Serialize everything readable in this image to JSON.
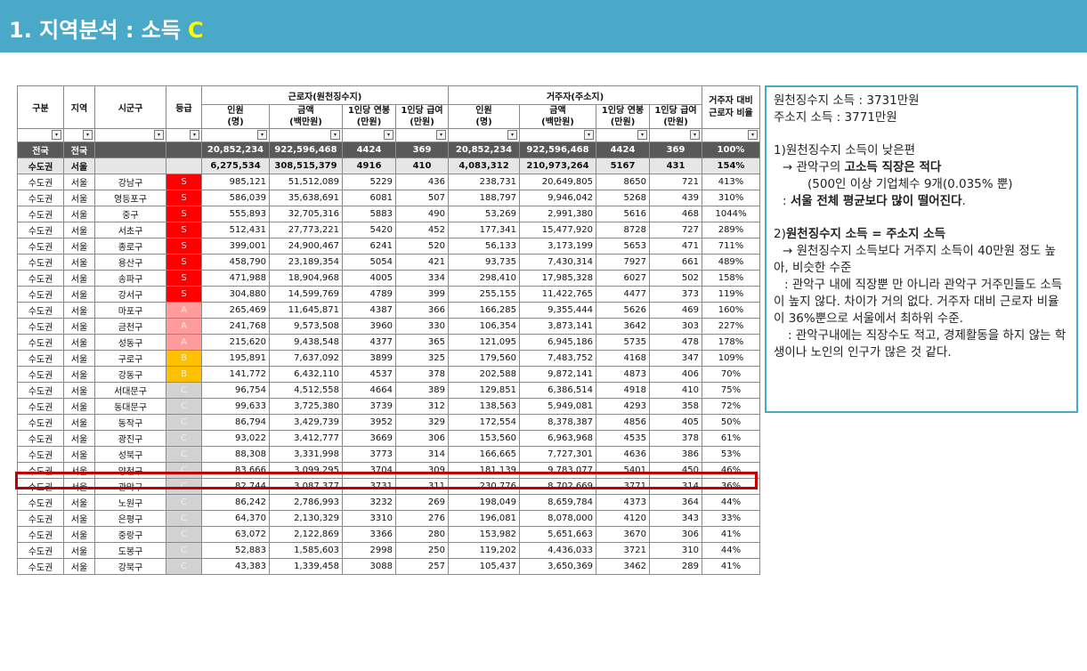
{
  "header": {
    "title": "1. 지역분석 : 소득",
    "grade": "C"
  },
  "table": {
    "head_left": [
      "구분",
      "지역",
      "시군구",
      "등급"
    ],
    "group_worker": "근로자(원천징수지)",
    "group_resident": "거주자(주소지)",
    "ratio_head": "거주자 대비 근로자 비율",
    "sub_cols": [
      "인원",
      "(명)",
      "금액",
      "(백만원)",
      "1인당 연봉",
      "(만원)",
      "1인당 급여",
      "(만원)"
    ],
    "filter_symbol": "▾",
    "rows": [
      [
        "전국",
        "전국",
        "",
        "",
        "20,852,234",
        "922,596,468",
        "4424",
        "369",
        "20,852,234",
        "922,596,468",
        "4424",
        "369",
        "100%"
      ],
      [
        "수도권",
        "서울",
        "",
        "",
        "6,275,534",
        "308,515,379",
        "4916",
        "410",
        "4,083,312",
        "210,973,264",
        "5167",
        "431",
        "154%"
      ],
      [
        "수도권",
        "서울",
        "강남구",
        "S",
        "985,121",
        "51,512,089",
        "5229",
        "436",
        "238,731",
        "20,649,805",
        "8650",
        "721",
        "413%"
      ],
      [
        "수도권",
        "서울",
        "영등포구",
        "S",
        "586,039",
        "35,638,691",
        "6081",
        "507",
        "188,797",
        "9,946,042",
        "5268",
        "439",
        "310%"
      ],
      [
        "수도권",
        "서울",
        "중구",
        "S",
        "555,893",
        "32,705,316",
        "5883",
        "490",
        "53,269",
        "2,991,380",
        "5616",
        "468",
        "1044%"
      ],
      [
        "수도권",
        "서울",
        "서초구",
        "S",
        "512,431",
        "27,773,221",
        "5420",
        "452",
        "177,341",
        "15,477,920",
        "8728",
        "727",
        "289%"
      ],
      [
        "수도권",
        "서울",
        "종로구",
        "S",
        "399,001",
        "24,900,467",
        "6241",
        "520",
        "56,133",
        "3,173,199",
        "5653",
        "471",
        "711%"
      ],
      [
        "수도권",
        "서울",
        "용산구",
        "S",
        "458,790",
        "23,189,354",
        "5054",
        "421",
        "93,735",
        "7,430,314",
        "7927",
        "661",
        "489%"
      ],
      [
        "수도권",
        "서울",
        "송파구",
        "S",
        "471,988",
        "18,904,968",
        "4005",
        "334",
        "298,410",
        "17,985,328",
        "6027",
        "502",
        "158%"
      ],
      [
        "수도권",
        "서울",
        "강서구",
        "S",
        "304,880",
        "14,599,769",
        "4789",
        "399",
        "255,155",
        "11,422,765",
        "4477",
        "373",
        "119%"
      ],
      [
        "수도권",
        "서울",
        "마포구",
        "A",
        "265,469",
        "11,645,871",
        "4387",
        "366",
        "166,285",
        "9,355,444",
        "5626",
        "469",
        "160%"
      ],
      [
        "수도권",
        "서울",
        "금천구",
        "A",
        "241,768",
        "9,573,508",
        "3960",
        "330",
        "106,354",
        "3,873,141",
        "3642",
        "303",
        "227%"
      ],
      [
        "수도권",
        "서울",
        "성동구",
        "A",
        "215,620",
        "9,438,548",
        "4377",
        "365",
        "121,095",
        "6,945,186",
        "5735",
        "478",
        "178%"
      ],
      [
        "수도권",
        "서울",
        "구로구",
        "B",
        "195,891",
        "7,637,092",
        "3899",
        "325",
        "179,560",
        "7,483,752",
        "4168",
        "347",
        "109%"
      ],
      [
        "수도권",
        "서울",
        "강동구",
        "B",
        "141,772",
        "6,432,110",
        "4537",
        "378",
        "202,588",
        "9,872,141",
        "4873",
        "406",
        "70%"
      ],
      [
        "수도권",
        "서울",
        "서대문구",
        "C",
        "96,754",
        "4,512,558",
        "4664",
        "389",
        "129,851",
        "6,386,514",
        "4918",
        "410",
        "75%"
      ],
      [
        "수도권",
        "서울",
        "동대문구",
        "C",
        "99,633",
        "3,725,380",
        "3739",
        "312",
        "138,563",
        "5,949,081",
        "4293",
        "358",
        "72%"
      ],
      [
        "수도권",
        "서울",
        "동작구",
        "C",
        "86,794",
        "3,429,739",
        "3952",
        "329",
        "172,554",
        "8,378,387",
        "4856",
        "405",
        "50%"
      ],
      [
        "수도권",
        "서울",
        "광진구",
        "C",
        "93,022",
        "3,412,777",
        "3669",
        "306",
        "153,560",
        "6,963,968",
        "4535",
        "378",
        "61%"
      ],
      [
        "수도권",
        "서울",
        "성북구",
        "C",
        "88,308",
        "3,331,998",
        "3773",
        "314",
        "166,665",
        "7,727,301",
        "4636",
        "386",
        "53%"
      ],
      [
        "수도권",
        "서울",
        "양천구",
        "C",
        "83,666",
        "3,099,295",
        "3704",
        "309",
        "181,139",
        "9,783,077",
        "5401",
        "450",
        "46%"
      ],
      [
        "수도권",
        "서울",
        "관악구",
        "C",
        "82,744",
        "3,087,377",
        "3731",
        "311",
        "230,776",
        "8,702,669",
        "3771",
        "314",
        "36%"
      ],
      [
        "수도권",
        "서울",
        "노원구",
        "C",
        "86,242",
        "2,786,993",
        "3232",
        "269",
        "198,049",
        "8,659,784",
        "4373",
        "364",
        "44%"
      ],
      [
        "수도권",
        "서울",
        "은평구",
        "C",
        "64,370",
        "2,130,329",
        "3310",
        "276",
        "196,081",
        "8,078,000",
        "4120",
        "343",
        "33%"
      ],
      [
        "수도권",
        "서울",
        "중랑구",
        "C",
        "63,072",
        "2,122,869",
        "3366",
        "280",
        "153,982",
        "5,651,663",
        "3670",
        "306",
        "41%"
      ],
      [
        "수도권",
        "서울",
        "도봉구",
        "C",
        "52,883",
        "1,585,603",
        "2998",
        "250",
        "119,202",
        "4,436,033",
        "3721",
        "310",
        "44%"
      ],
      [
        "수도권",
        "서울",
        "강북구",
        "C",
        "43,383",
        "1,339,458",
        "3088",
        "257",
        "105,437",
        "3,650,369",
        "3462",
        "289",
        "41%"
      ]
    ]
  },
  "notes": {
    "line1": "원천징수지 소득 : 3731만원",
    "line2": "주소지 소득 : 3771만원",
    "p1_head": "1)원천징수지 소득이 낮은편",
    "p1_l1_pre": "→ 관악구의 ",
    "p1_l1_bold": "고소득 직장은 적다",
    "p1_l2": "(500인 이상 기업체수 9개(0.035% 뿐)",
    "p1_l3_pre": ": ",
    "p1_l3_bold": "서울 전체 평균보다 많이 떨어진다",
    "p1_l3_post": ".",
    "p2_head_pre": "2)",
    "p2_head_bold": "원천징수지 소득 = 주소지 소득",
    "p2_l1": "→ 원천징수지 소득보다 거주지 소득이 40만원 정도 높아, 비슷한 수준",
    "p2_l2": ": 관악구 내에 직장뿐 만 아니라 관악구 거주민들도 소득이 높지 않다. 차이가 거의 없다. 거주자 대비 근로자 비율이 36%뿐으로 서울에서 최하위 수준.",
    "p2_l3": ": 관악구내에는 직장수도 적고, 경제활동을 하지 않는 학생이나 노인의 인구가 많은 것 같다."
  }
}
